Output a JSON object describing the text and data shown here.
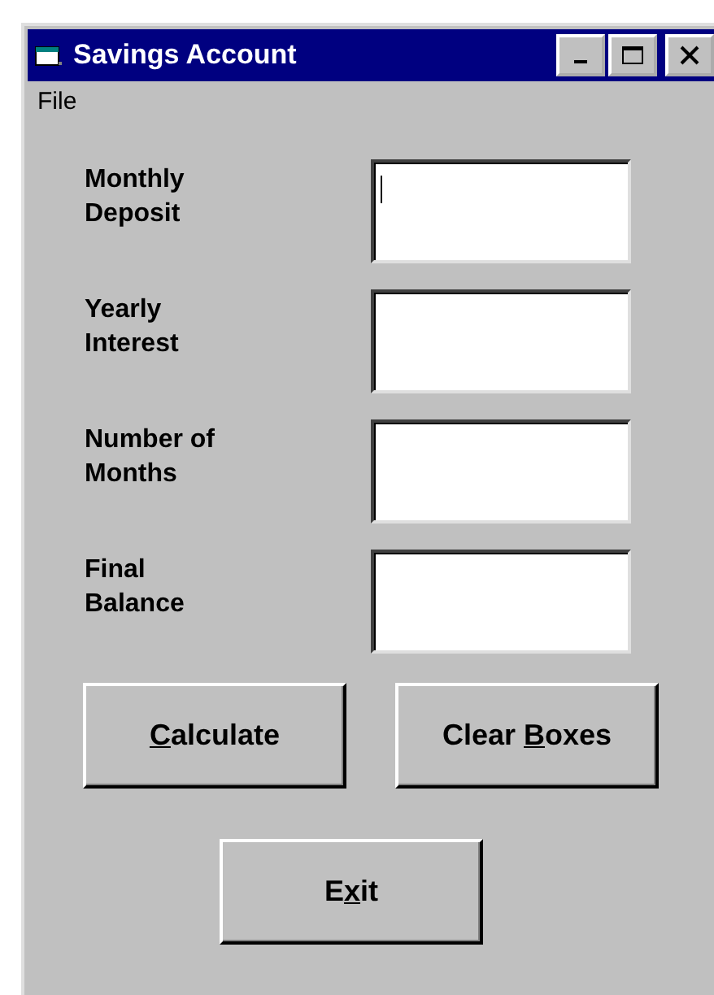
{
  "window": {
    "title": "Savings Account"
  },
  "menu": [
    {
      "label": "File"
    }
  ],
  "fields": [
    {
      "label": "Monthly Deposit",
      "focused": true
    },
    {
      "label": "Yearly Interest",
      "focused": false
    },
    {
      "label": "Number of Months",
      "focused": false
    },
    {
      "label": "Final Balance",
      "focused": false
    }
  ],
  "buttons": [
    {
      "key": "C",
      "after": "alculate"
    },
    {
      "before": "Clear ",
      "key": "B",
      "after": "oxes"
    },
    {
      "before": "E",
      "key": "x",
      "after": "it"
    }
  ]
}
